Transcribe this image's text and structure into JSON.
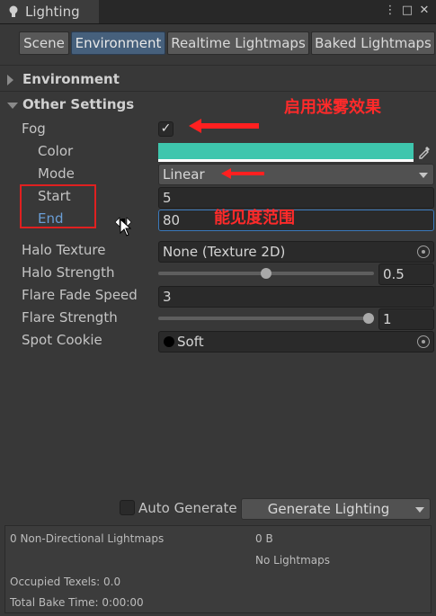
{
  "window": {
    "title": "Lighting",
    "menu_glyph": "⋮",
    "maximize_glyph": "□",
    "close_glyph": "✕"
  },
  "tabs": [
    {
      "label": "Scene",
      "active": false
    },
    {
      "label": "Environment",
      "active": true
    },
    {
      "label": "Realtime Lightmaps",
      "active": false
    },
    {
      "label": "Baked Lightmaps",
      "active": false
    }
  ],
  "sections": {
    "environment": {
      "label": "Environment",
      "expanded": false
    },
    "other_settings": {
      "label": "Other Settings",
      "expanded": true
    }
  },
  "fog": {
    "label": "Fog",
    "checked": true,
    "check_glyph": "✓",
    "color_label": "Color",
    "color_value": "#3ec6ad",
    "mode_label": "Mode",
    "mode_value": "Linear",
    "start_label": "Start",
    "start_value": "5",
    "end_label": "End",
    "end_value": "80"
  },
  "halo_texture": {
    "label": "Halo Texture",
    "value": "None (Texture 2D)"
  },
  "halo_strength": {
    "label": "Halo Strength",
    "value": "0.5",
    "fraction": 0.5
  },
  "flare_fade_speed": {
    "label": "Flare Fade Speed",
    "value": "3"
  },
  "flare_strength": {
    "label": "Flare Strength",
    "value": "1",
    "fraction": 1.0
  },
  "spot_cookie": {
    "label": "Spot Cookie",
    "value": "Soft"
  },
  "annotations": {
    "fog_note": "启用迷雾效果",
    "range_note": "能见度范围",
    "color": "#ff2a2a"
  },
  "bottom": {
    "auto_generate_label": "Auto Generate",
    "auto_generate_checked": false,
    "generate_button": "Generate Lighting",
    "stats": {
      "lightmaps": "0 Non-Directional Lightmaps",
      "size": "0 B",
      "no_lightmaps": "No Lightmaps",
      "texels": "Occupied Texels: 0.0",
      "bake_time": "Total Bake Time: 0:00:00"
    }
  },
  "icons": [
    "lightbulb-icon",
    "menu-icon",
    "maximize-icon",
    "close-icon",
    "eyedropper-icon",
    "object-picker-icon",
    "dropdown-arrow-icon",
    "cursor-icon",
    "resize-cursor-icon"
  ]
}
